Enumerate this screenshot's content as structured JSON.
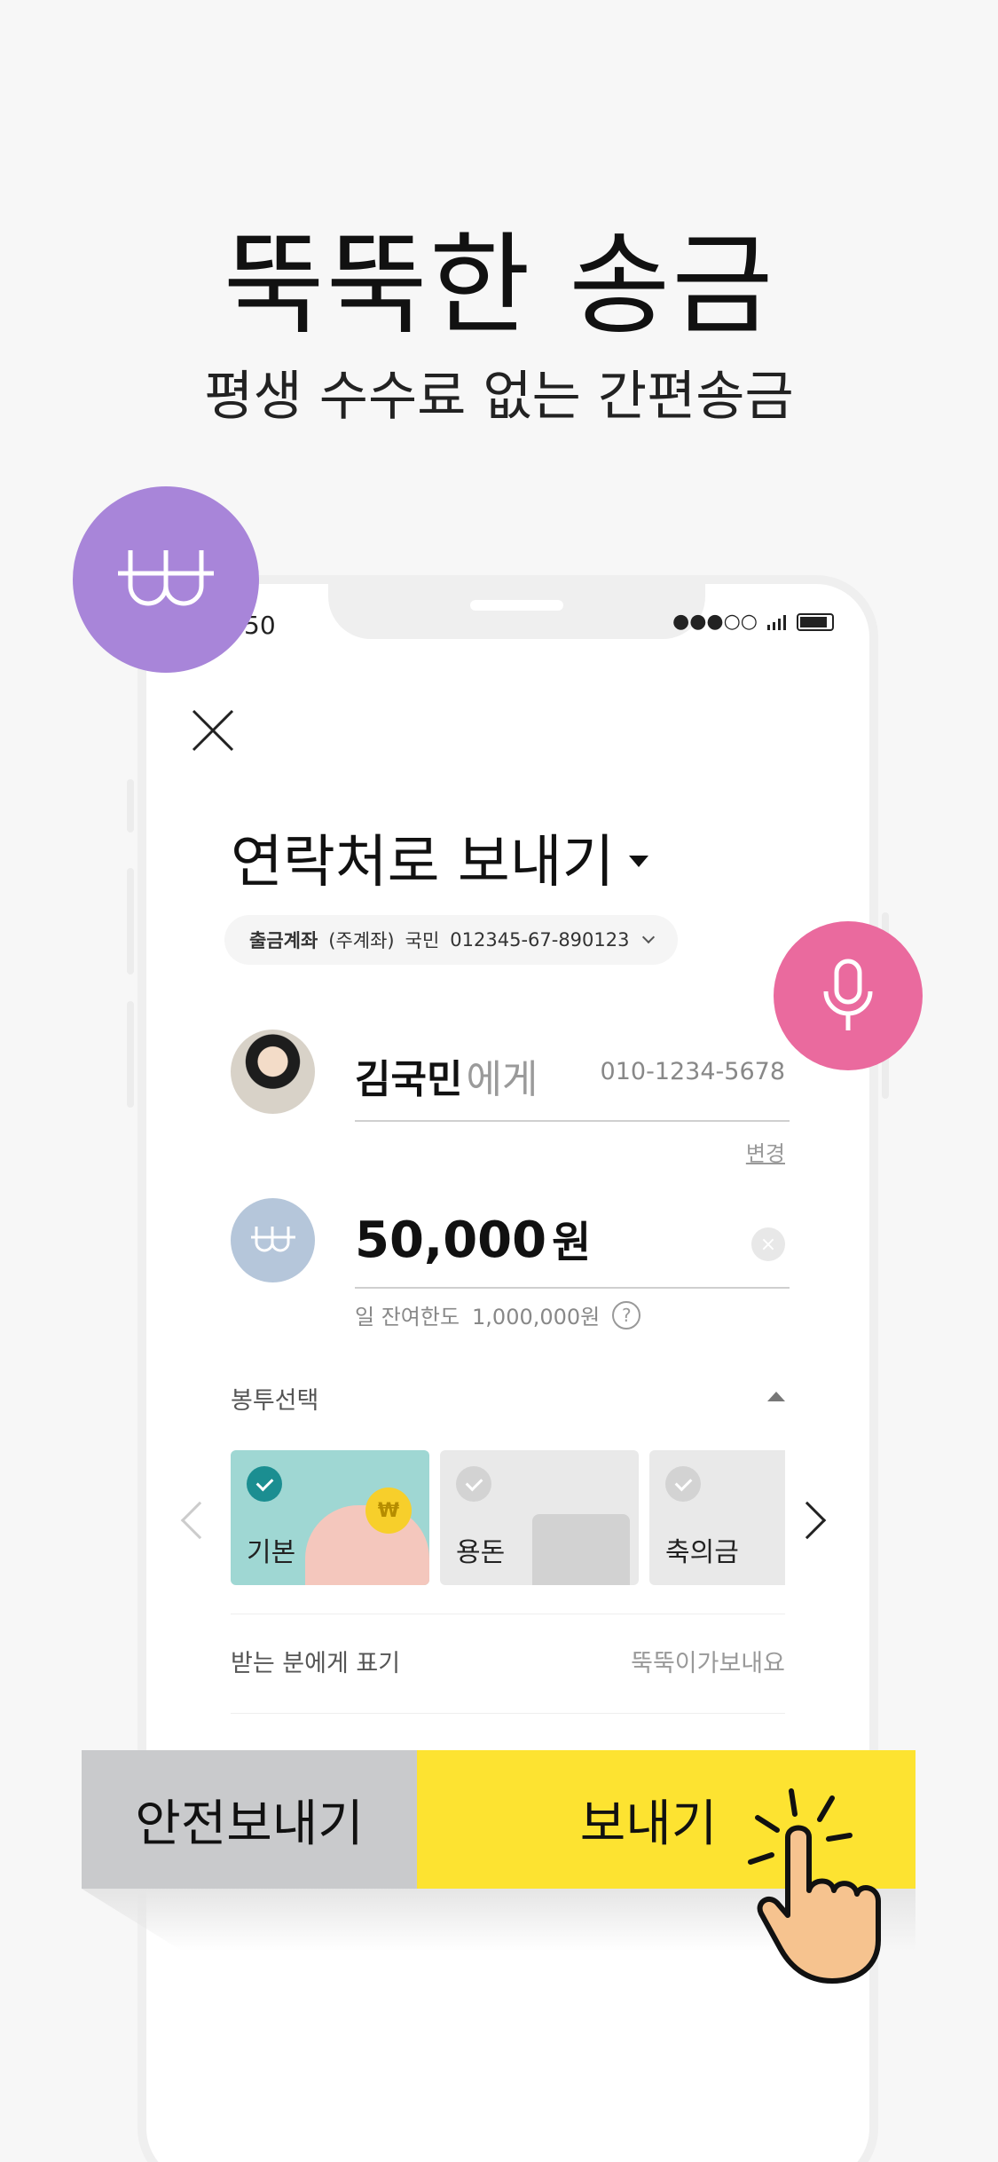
{
  "promo": {
    "headline": "뚝뚝한 송금",
    "subline": "평생 수수료 없는 간편송금"
  },
  "status_bar": {
    "time": "50",
    "signal": "●●●○○"
  },
  "transfer": {
    "title": "연락처로 보내기",
    "account": {
      "label": "출금계좌",
      "type": "(주계좌)",
      "bank": "국민",
      "number": "012345-67-890123"
    },
    "recipient": {
      "name": "김국민",
      "suffix": "에게",
      "phone": "010-1234-5678",
      "change_label": "변경"
    },
    "amount": {
      "value": "50,000",
      "unit": "원",
      "clear_label": "×"
    },
    "limit": {
      "label": "일 잔여한도",
      "value": "1,000,000원",
      "help": "?"
    },
    "envelope": {
      "label": "봉투선택",
      "options": [
        {
          "name": "기본",
          "selected": true
        },
        {
          "name": "용돈",
          "selected": false
        },
        {
          "name": "축의금",
          "selected": false
        }
      ],
      "coin_symbol": "₩"
    },
    "display": {
      "label": "받는 분에게 표기",
      "value": "뚝뚝이가보내요"
    }
  },
  "buttons": {
    "safe_send": "안전보내기",
    "send": "보내기"
  },
  "colors": {
    "accent_yellow": "#fde331",
    "purple_badge": "#a885d9",
    "pink_badge": "#ea6a9e",
    "teal_envelope": "#9fd7d3"
  }
}
